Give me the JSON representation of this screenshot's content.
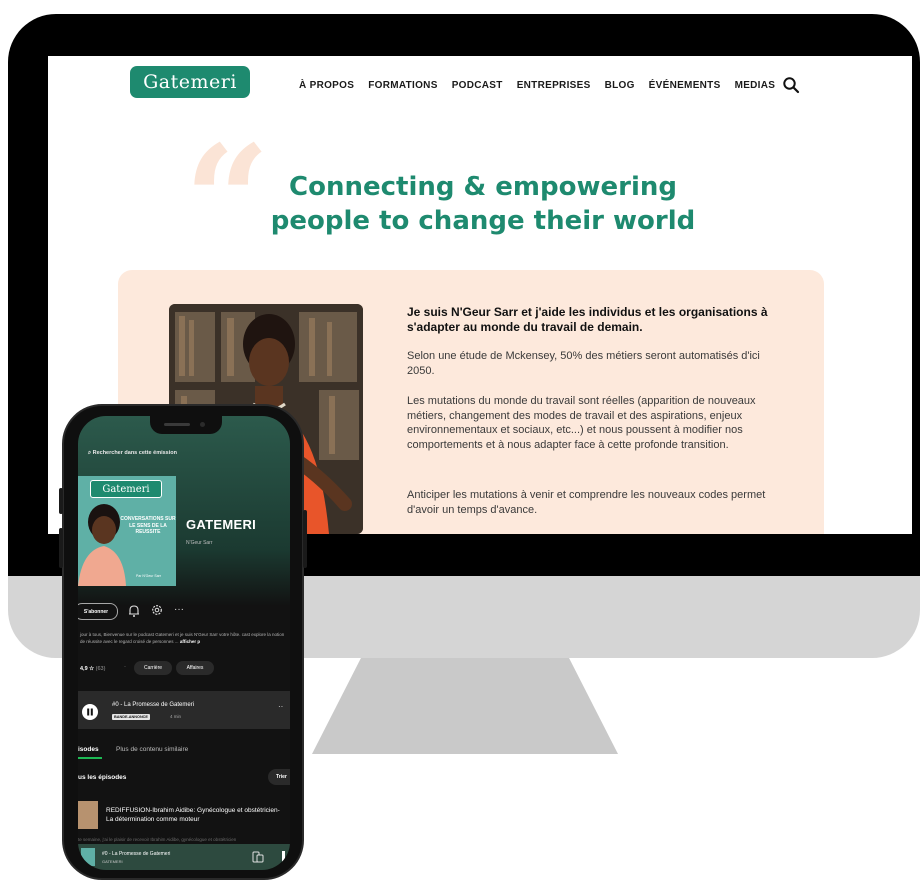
{
  "desktop": {
    "logo_text": "Gatemeri",
    "nav": [
      "À PROPOS",
      "FORMATIONS",
      "PODCAST",
      "ENTREPRISES",
      "BLOG",
      "ÉVÉNEMENTS",
      "MEDIAS"
    ],
    "headline_line1": "Connecting & empowering",
    "headline_line2": "people to change their world",
    "intro": "Je suis N'Geur Sarr et j'aide les individus et les organisations à s'adapter au monde du travail de demain.",
    "paragraphs": [
      "Selon une étude de Mckensey, 50% des métiers seront automatisés d'ici 2050.",
      "Les mutations du monde du travail sont réelles (apparition de nouveaux métiers, changement des modes de travail et des aspirations, enjeux environnementaux et sociaux, etc...) et nous poussent à modifier nos comportements et à nous adapter face à cette profonde transition.",
      "Anticiper les mutations à venir et comprendre les nouveaux codes permet d'avoir un temps d'avance."
    ],
    "colors": {
      "brand": "#1e8a6f",
      "card": "#fde9dc",
      "quote": "#fbe4d6"
    }
  },
  "phone": {
    "search_label": "Rechercher dans cette émission",
    "cover": {
      "logo": "Gatemeri",
      "tagline": "CONVERSATIONS SUR LE SENS DE LA REUSSITE",
      "byline": "Par N'Geur Sarr"
    },
    "show_title": "GATEMERI",
    "author": "N'Geur Sarr",
    "subscribe_label": "S'abonner",
    "description": "jour à tous, Bienvenue sur le podcast Gatemeri et je suis N'Geur Sarr votre hôte. cast explore la notion de réussite avec le regard croisé de personnes ...",
    "show_more": "afficher p",
    "rating": "4,9 ☆",
    "rating_count": "(63)",
    "chips": [
      "Carrière",
      "Affaires"
    ],
    "now_episode": {
      "title": "#0 - La Promesse de Gatemeri",
      "badge": "BANDE-ANNONCE",
      "duration": "4 min"
    },
    "tabs": [
      "isodes",
      "Plus de contenu similaire"
    ],
    "section_title": "us les épisodes",
    "sort_label": "Trier",
    "episode": {
      "title": "REDIFFUSION-Ibrahim Aidibe: Gynécologue et obstétricien- La détermination comme moteur",
      "snippet": "te semaine, j'ai le plaisir de recevoir Ibrahim Aidibe, gynécologue et obstétricien"
    },
    "mini_player": {
      "title": "#0 - La Promesse de Gatemeri",
      "subtitle": "GATEMERI"
    }
  }
}
